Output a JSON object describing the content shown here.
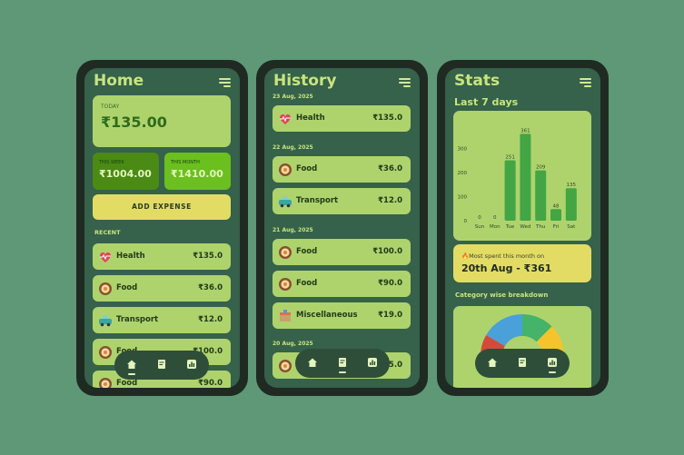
{
  "home": {
    "title": "Home",
    "today_label": "TODAY",
    "today_amount": "₹135.00",
    "week_label": "THIS WEEK",
    "week_amount": "₹1004.00",
    "month_label": "THIS MONTH",
    "month_amount": "₹1410.00",
    "add_button": "ADD EXPENSE",
    "recent_label": "RECENT",
    "recent": [
      {
        "name": "Health",
        "amount": "₹135.0",
        "icon": "heart-pulse-icon"
      },
      {
        "name": "Food",
        "amount": "₹36.0",
        "icon": "food-icon"
      },
      {
        "name": "Transport",
        "amount": "₹12.0",
        "icon": "car-icon"
      },
      {
        "name": "Food",
        "amount": "₹100.0",
        "icon": "food-icon"
      },
      {
        "name": "Food",
        "amount": "₹90.0",
        "icon": "food-icon"
      }
    ]
  },
  "history": {
    "title": "History",
    "groups": [
      {
        "date": "23 Aug, 2025",
        "items": [
          {
            "name": "Health",
            "amount": "₹135.0",
            "icon": "heart-pulse-icon"
          }
        ]
      },
      {
        "date": "22 Aug, 2025",
        "items": [
          {
            "name": "Food",
            "amount": "₹36.0",
            "icon": "food-icon"
          },
          {
            "name": "Transport",
            "amount": "₹12.0",
            "icon": "car-icon"
          }
        ]
      },
      {
        "date": "21 Aug, 2025",
        "items": [
          {
            "name": "Food",
            "amount": "₹100.0",
            "icon": "food-icon"
          },
          {
            "name": "Food",
            "amount": "₹90.0",
            "icon": "food-icon"
          },
          {
            "name": "Miscellaneous",
            "amount": "₹19.0",
            "icon": "misc-icon"
          }
        ]
      },
      {
        "date": "20 Aug, 2025",
        "items": [
          {
            "name": "",
            "amount": "₹5.0",
            "icon": "food-icon"
          }
        ]
      }
    ]
  },
  "stats": {
    "title": "Stats",
    "subtitle": "Last 7 days",
    "most_label": "Most spent this month on",
    "most_value": "20th Aug - ₹361",
    "breakdown_label": "Category wise breakdown"
  },
  "nav": {
    "items": [
      "home-icon",
      "receipt-icon",
      "stats-icon"
    ]
  },
  "colors": {
    "background": "#5e9877",
    "phone_frame": "#1f2a22",
    "screen": "#36614a",
    "card": "#aed36d",
    "accent_yellow": "#e3dc64",
    "heading": "#c7e57f",
    "bar": "#43a544",
    "week_card": "#4a8a15",
    "month_card": "#6bbf1f"
  },
  "chart_data": {
    "type": "bar",
    "categories": [
      "Sun",
      "Mon",
      "Tue",
      "Wed",
      "Thu",
      "Fri",
      "Sat"
    ],
    "values": [
      0,
      0,
      251,
      361,
      209,
      48,
      135
    ],
    "ylim": [
      0,
      400
    ],
    "yticks": [
      0,
      100,
      200,
      300
    ],
    "grid": false
  },
  "donut_data": {
    "type": "pie",
    "colors": [
      "#d44a3a",
      "#4aa0d8",
      "#45b36a",
      "#f5c42c"
    ]
  }
}
